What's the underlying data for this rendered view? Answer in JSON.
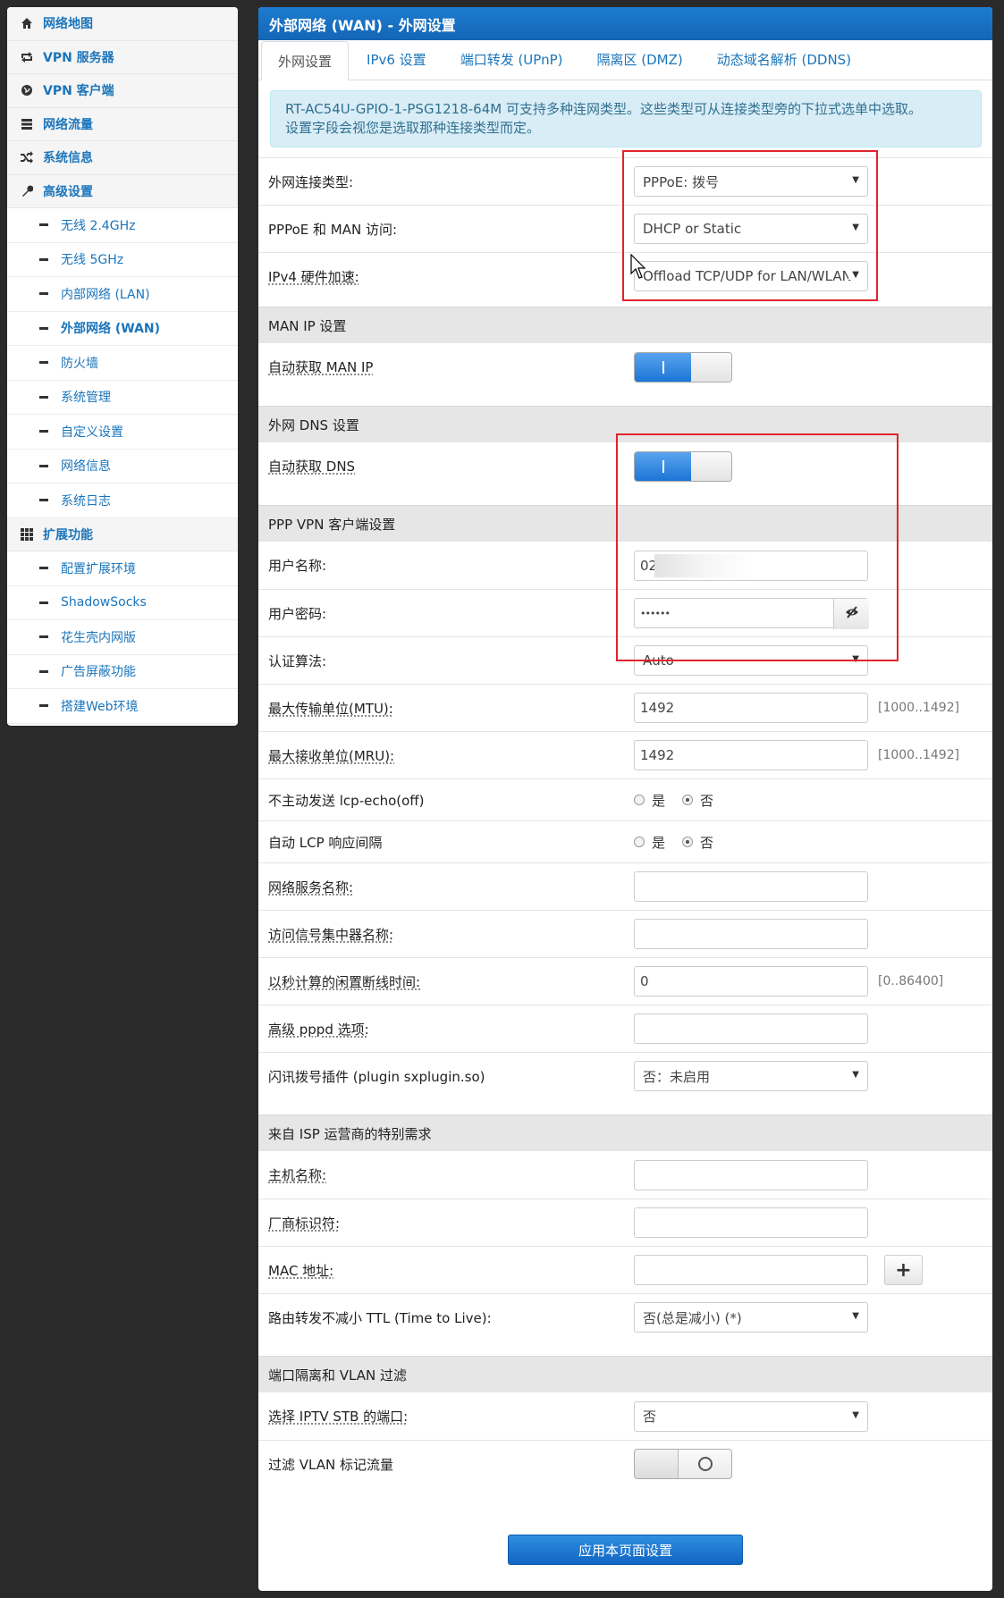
{
  "sidebar": {
    "top": [
      {
        "label": "网络地图",
        "icon": "home-icon"
      },
      {
        "label": "VPN 服务器",
        "icon": "retweet-icon"
      },
      {
        "label": "VPN 客户端",
        "icon": "globe-icon"
      },
      {
        "label": "网络流量",
        "icon": "list-icon"
      },
      {
        "label": "系统信息",
        "icon": "shuffle-icon"
      },
      {
        "label": "高级设置",
        "icon": "wrench-icon"
      }
    ],
    "advanced": [
      "无线 2.4GHz",
      "无线 5GHz",
      "内部网络 (LAN)",
      "外部网络 (WAN)",
      "防火墙",
      "系统管理",
      "自定义设置",
      "网络信息",
      "系统日志"
    ],
    "ext_header": {
      "label": "扩展功能",
      "icon": "grid-icon"
    },
    "ext": [
      "配置扩展环境",
      "ShadowSocks",
      "花生壳内网版",
      "广告屏蔽功能",
      "搭建Web环境"
    ]
  },
  "header": {
    "title": "外部网络 (WAN) - 外网设置"
  },
  "tabs": [
    "外网设置",
    "IPv6 设置",
    "端口转发 (UPnP)",
    "隔离区 (DMZ)",
    "动态域名解析 (DDNS)"
  ],
  "info": {
    "line1": "RT-AC54U-GPIO-1-PSG1218-64M 可支持多种连网类型。这些类型可从连接类型旁的下拉式选单中选取。",
    "line2": "设置字段会视您是选取那种连接类型而定。"
  },
  "wan": {
    "conn_type_label": "外网连接类型:",
    "conn_type_value": "PPPoE: 拨号",
    "man_access_label": "PPPoE 和 MAN 访问:",
    "man_access_value": "DHCP or Static",
    "hw_accel_label": "IPv4 硬件加速:",
    "hw_accel_value": "Offload TCP/UDP for LAN/WLAN"
  },
  "man": {
    "section": "MAN IP 设置",
    "auto_label": "自动获取 MAN IP",
    "auto_on": true
  },
  "dns": {
    "section": "外网 DNS 设置",
    "auto_label": "自动获取 DNS",
    "auto_on": true
  },
  "ppp": {
    "section": "PPP VPN 客户端设置",
    "user_label": "用户名称:",
    "user_value": "02",
    "pass_label": "用户密码:",
    "pass_value": "••••••",
    "auth_label": "认证算法:",
    "auth_value": "Auto",
    "mtu_label": "最大传输单位(MTU):",
    "mtu_value": "1492",
    "mtu_range": "[1000..1492]",
    "mru_label": "最大接收单位(MRU):",
    "mru_value": "1492",
    "mru_range": "[1000..1492]",
    "lcp_echo_label": "不主动发送 lcp-echo(off)",
    "lcp_interval_label": "自动 LCP 响应间隔",
    "yes": "是",
    "no": "否",
    "service_label": "网络服务名称:",
    "service_value": "",
    "ac_label": "访问信号集中器名称:",
    "ac_value": "",
    "idle_label": "以秒计算的闲置断线时间:",
    "idle_value": "0",
    "idle_range": "[0..86400]",
    "pppd_label": "高级 pppd 选项:",
    "pppd_value": "",
    "plugin_label": "闪讯拨号插件 (plugin sxplugin.so)",
    "plugin_value": "否：未启用"
  },
  "isp": {
    "section": "来自 ISP 运营商的特别需求",
    "host_label": "主机名称:",
    "host_value": "",
    "vendor_label": "厂商标识符:",
    "vendor_value": "",
    "mac_label": "MAC 地址:",
    "mac_value": "",
    "mac_btn": "+",
    "ttl_label": "路由转发不减小 TTL (Time to Live):",
    "ttl_value": "否(总是减小) (*)"
  },
  "vlan": {
    "section": "端口隔离和 VLAN 过滤",
    "iptv_label": "选择 IPTV STB 的端口:",
    "iptv_value": "否",
    "filter_label": "过滤 VLAN 标记流量",
    "filter_on": false
  },
  "apply_label": "应用本页面设置",
  "colors": {
    "accent": "#1b75bb",
    "header": "#1565b5",
    "highlight_box": "#e1242b",
    "page_bg": "#2a2a2a"
  }
}
